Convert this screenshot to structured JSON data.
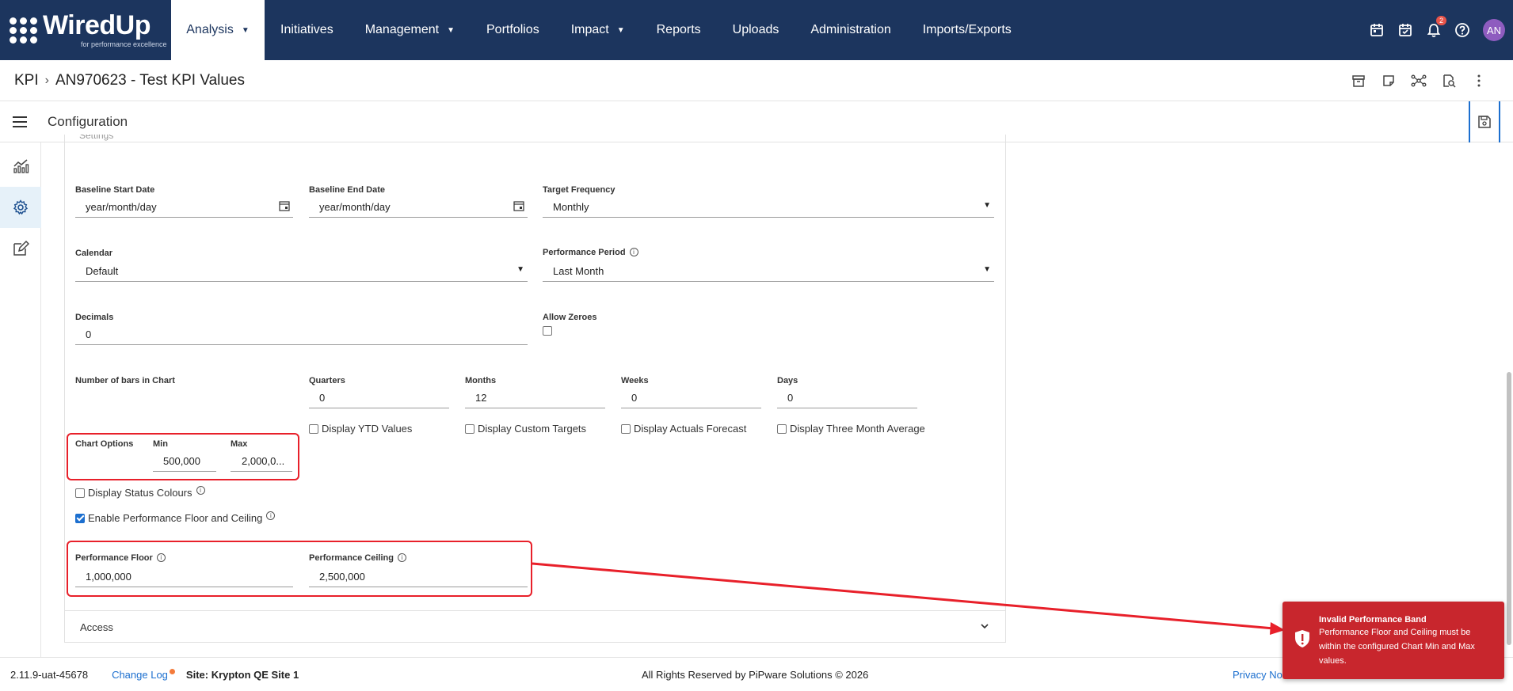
{
  "brand": {
    "logo_text": "WiredUp",
    "logo_tagline": "for performance excellence"
  },
  "nav": {
    "items": [
      {
        "label": "Analysis",
        "has_caret": true,
        "active": true
      },
      {
        "label": "Initiatives",
        "has_caret": false
      },
      {
        "label": "Management",
        "has_caret": true
      },
      {
        "label": "Portfolios",
        "has_caret": false
      },
      {
        "label": "Impact",
        "has_caret": true
      },
      {
        "label": "Reports",
        "has_caret": false
      },
      {
        "label": "Uploads",
        "has_caret": false
      },
      {
        "label": "Administration",
        "has_caret": false
      },
      {
        "label": "Imports/Exports",
        "has_caret": false
      }
    ],
    "notification_count": "2",
    "avatar_initials": "AN"
  },
  "breadcrumb": {
    "root": "KPI",
    "current": "AN970623 - Test KPI Values"
  },
  "config": {
    "title": "Configuration",
    "section_label": "Settings"
  },
  "form": {
    "baseline_start": {
      "label": "Baseline Start Date",
      "value": "year/month/day"
    },
    "baseline_end": {
      "label": "Baseline End Date",
      "value": "year/month/day"
    },
    "target_frequency": {
      "label": "Target Frequency",
      "value": "Monthly"
    },
    "calendar": {
      "label": "Calendar",
      "value": "Default"
    },
    "performance_period": {
      "label": "Performance Period",
      "value": "Last Month"
    },
    "decimals": {
      "label": "Decimals",
      "value": "0"
    },
    "allow_zeroes": {
      "label": "Allow Zeroes",
      "checked": false
    },
    "bars": {
      "label": "Number of bars in Chart",
      "quarters": {
        "label": "Quarters",
        "value": "0"
      },
      "months": {
        "label": "Months",
        "value": "12"
      },
      "weeks": {
        "label": "Weeks",
        "value": "0"
      },
      "days": {
        "label": "Days",
        "value": "0"
      }
    },
    "display_ytd": {
      "label": "Display YTD Values",
      "checked": false
    },
    "display_custom_targets": {
      "label": "Display Custom Targets",
      "checked": false
    },
    "display_actuals_forecast": {
      "label": "Display Actuals Forecast",
      "checked": false
    },
    "display_three_month_avg": {
      "label": "Display Three Month Average",
      "checked": false
    },
    "chart_options": {
      "label": "Chart Options",
      "min": {
        "label": "Min",
        "value": "500,000"
      },
      "max": {
        "label": "Max",
        "value": "2,000,0..."
      }
    },
    "display_status_colours": {
      "label": "Display Status Colours",
      "checked": false
    },
    "enable_floor_ceiling": {
      "label": "Enable Performance Floor and Ceiling",
      "checked": true
    },
    "performance_floor": {
      "label": "Performance Floor",
      "value": "1,000,000"
    },
    "performance_ceiling": {
      "label": "Performance Ceiling",
      "value": "2,500,000"
    }
  },
  "access": {
    "label": "Access"
  },
  "footer": {
    "version": "2.11.9-uat-45678",
    "change_log": "Change Log",
    "site": "Site: Krypton QE Site 1",
    "rights": "All Rights Reserved by PiPware Solutions © 2026",
    "privacy": "Privacy No"
  },
  "toast": {
    "title": "Invalid Performance Band",
    "message": "Performance Floor and Ceiling must be within the configured Chart Min and Max values."
  },
  "colors": {
    "nav_bg": "#1c355e",
    "accent": "#1c6fcf",
    "error": "#c8262d",
    "highlight": "#e8202a"
  }
}
